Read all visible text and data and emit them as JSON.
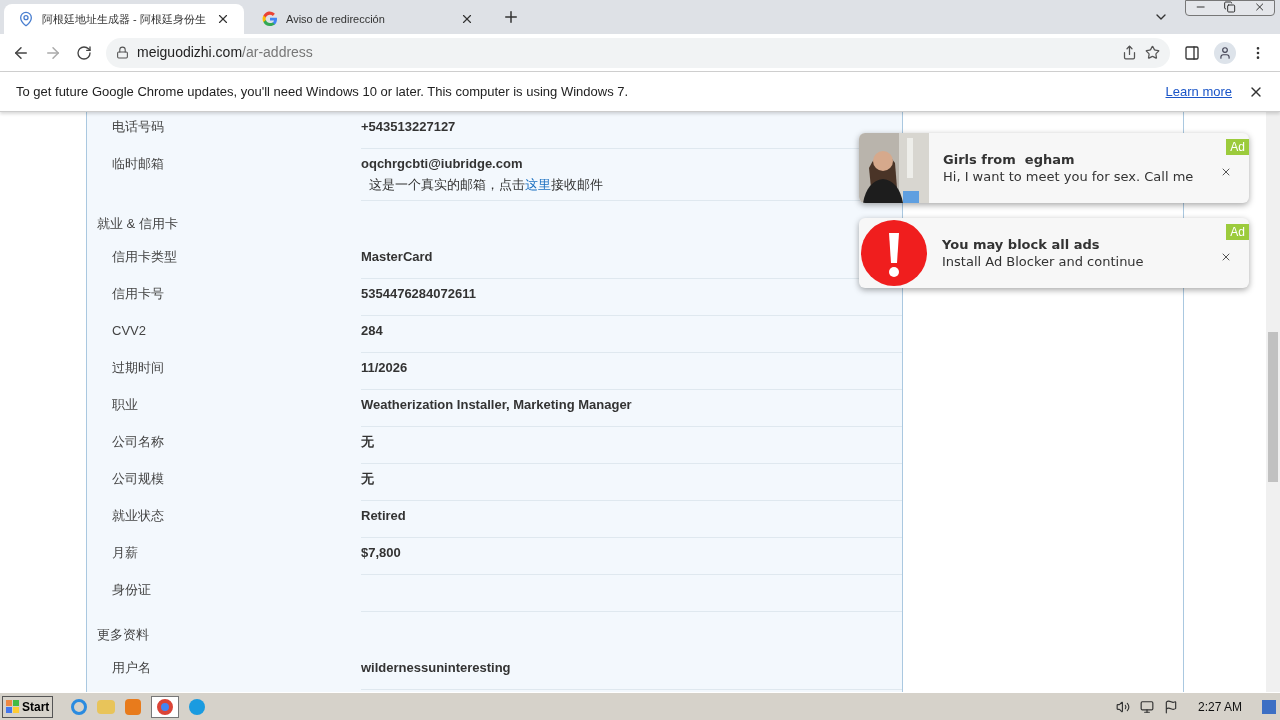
{
  "tabs": [
    {
      "title": "阿根廷地址生成器 - 阿根廷身份生",
      "selected": true
    },
    {
      "title": "Aviso de redirección",
      "selected": false
    }
  ],
  "address_bar": {
    "domain": "meiguodizhi.com",
    "path": "/ar-address"
  },
  "infobar": {
    "message": "To get future Google Chrome updates, you'll need Windows 10 or later. This computer is using Windows 7.",
    "link": "Learn more"
  },
  "groups": [
    {
      "rows": [
        {
          "label": "电话号码",
          "value": "+543513227127"
        },
        {
          "label": "临时邮箱",
          "value": "oqchrgcbti@iubridge.com",
          "note": {
            "before": "这是一个真实的邮箱，点击",
            "link": "这里",
            "after": "接收邮件"
          }
        }
      ]
    },
    {
      "heading": "就业 & 信用卡",
      "rows": [
        {
          "label": "信用卡类型",
          "value": "MasterCard"
        },
        {
          "label": "信用卡号",
          "value": "5354476284072611"
        },
        {
          "label": "CVV2",
          "value": "284"
        },
        {
          "label": "过期时间",
          "value": "11/2026"
        },
        {
          "label": "职业",
          "value": "Weatherization Installer, Marketing Manager"
        },
        {
          "label": "公司名称",
          "value": "无"
        },
        {
          "label": "公司规模",
          "value": "无"
        },
        {
          "label": "就业状态",
          "value": "Retired"
        },
        {
          "label": "月薪",
          "value": "$7,800"
        },
        {
          "label": "身份证",
          "value": ""
        }
      ]
    },
    {
      "heading": "更多资料",
      "rows": [
        {
          "label": "用户名",
          "value": "wildernessuninteresting"
        }
      ]
    }
  ],
  "ads": [
    {
      "title": "Girls from  egham",
      "text": "Hi, I want to meet you for sex. Call me",
      "badge": "Ad"
    },
    {
      "kind": "alert",
      "title": "You may block all ads",
      "text": "Install Ad Blocker and continue",
      "badge": "Ad"
    }
  ],
  "taskbar": {
    "start": "Start",
    "time": "2:27 AM"
  }
}
